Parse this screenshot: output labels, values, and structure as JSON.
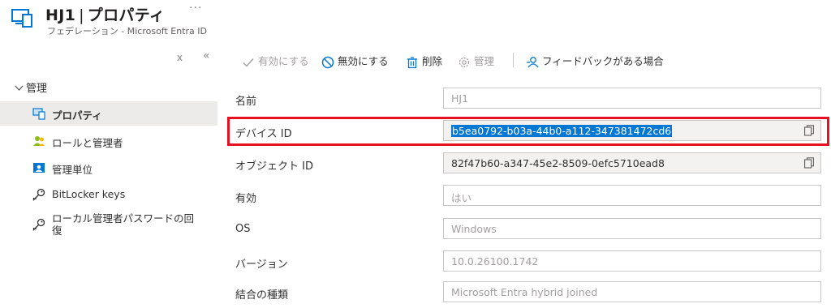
{
  "header": {
    "title_name": "HJ1",
    "title_separator": "|",
    "title_page": "プロパティ",
    "more": "···",
    "subtitle": "フェデレーション - Microsoft Entra ID"
  },
  "sidebar": {
    "collapse_x": "x",
    "collapse_arrows": "«",
    "group_label": "管理",
    "items": [
      {
        "label": "プロパティ",
        "icon": "properties-icon",
        "selected": true
      },
      {
        "label": "ロールと管理者",
        "icon": "users-roles-icon",
        "selected": false
      },
      {
        "label": "管理単位",
        "icon": "admin-unit-icon",
        "selected": false
      },
      {
        "label": "BitLocker keys",
        "icon": "key-icon",
        "selected": false
      },
      {
        "label": "ローカル管理者パスワードの回復",
        "icon": "key-icon",
        "selected": false
      }
    ]
  },
  "toolbar": {
    "enable": "有効にする",
    "disable": "無効にする",
    "delete": "削除",
    "manage": "管理",
    "feedback": "フィードバックがある場合"
  },
  "properties": [
    {
      "label": "名前",
      "value": "HJ1",
      "readonly": false
    },
    {
      "label": "デバイス ID",
      "value": "b5ea0792-b03a-44b0-a112-347381472cd6",
      "readonly": true
    },
    {
      "label": "オブジェクト ID",
      "value": "82f47b60-a347-45e2-8509-0efc5710ead8",
      "readonly": true
    },
    {
      "label": "有効",
      "value": "はい",
      "readonly": false
    },
    {
      "label": "OS",
      "value": "Windows",
      "readonly": false
    },
    {
      "label": "バージョン",
      "value": "10.0.26100.1742",
      "readonly": false
    },
    {
      "label": "結合の種類",
      "value": "Microsoft Entra hybrid joined",
      "readonly": false
    }
  ],
  "colors": {
    "accent": "#0078d4",
    "highlight_border": "#e81123",
    "selected_nav_bg": "#edebe9",
    "disabled_text": "#a19f9d"
  }
}
